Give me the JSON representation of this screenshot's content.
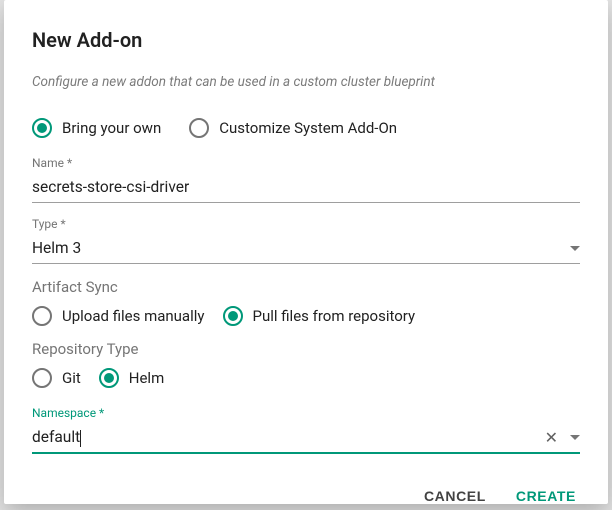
{
  "title": "New Add-on",
  "subtitle": "Configure a new addon that can be used in a custom cluster blueprint",
  "addon_kind": {
    "options": [
      {
        "label": "Bring your own",
        "selected": true
      },
      {
        "label": "Customize System Add-On",
        "selected": false
      }
    ]
  },
  "fields": {
    "name": {
      "label": "Name *",
      "value": "secrets-store-csi-driver"
    },
    "type": {
      "label": "Type *",
      "value": "Helm 3"
    },
    "namespace": {
      "label": "Namespace *",
      "value": "default"
    }
  },
  "artifact_sync": {
    "label": "Artifact Sync",
    "options": [
      {
        "label": "Upload files manually",
        "selected": false
      },
      {
        "label": "Pull files from repository",
        "selected": true
      }
    ]
  },
  "repo_type": {
    "label": "Repository Type",
    "options": [
      {
        "label": "Git",
        "selected": false
      },
      {
        "label": "Helm",
        "selected": true
      }
    ]
  },
  "actions": {
    "cancel": "CANCEL",
    "create": "CREATE"
  }
}
